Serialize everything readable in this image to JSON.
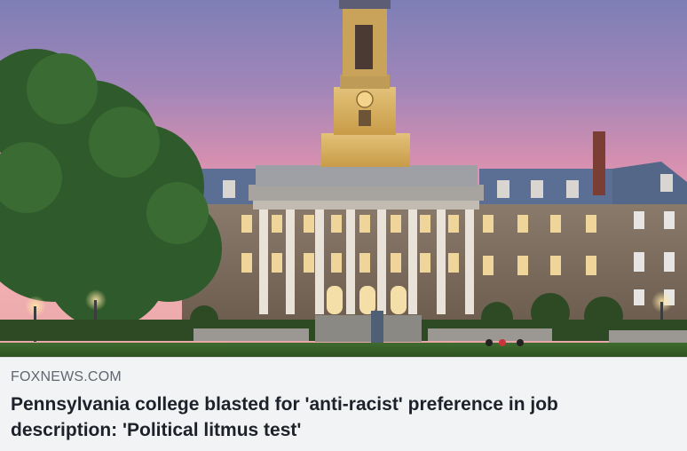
{
  "link_preview": {
    "image_alt": "Old Main building with clock tower at dusk",
    "source_domain": "FOXNEWS.COM",
    "headline": "Pennsylvania college blasted for 'anti-racist' preference in job description: 'Political litmus test'"
  },
  "colors": {
    "meta_background": "#f2f3f5",
    "source_text": "#606770",
    "headline_text": "#1d2129"
  }
}
